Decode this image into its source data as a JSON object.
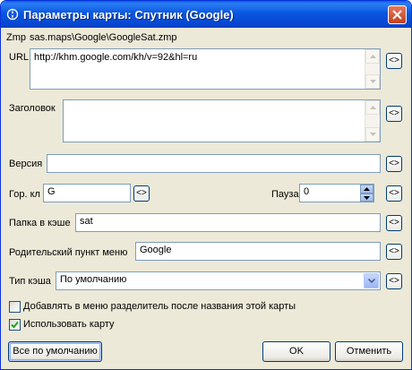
{
  "window": {
    "title": "Параметры карты: Спутник (Google)"
  },
  "zmp": {
    "label": "Zmp",
    "path": "sas.maps\\Google\\GoogleSat.zmp"
  },
  "url": {
    "label": "URL",
    "value": "http://khm.google.com/kh/v=92&hl=ru"
  },
  "header_field": {
    "label": "Заголовок",
    "value": ""
  },
  "version": {
    "label": "Версия",
    "value": ""
  },
  "hotkey": {
    "label": "Гор. кл",
    "value": "G"
  },
  "pause": {
    "label": "Пауза",
    "value": "0"
  },
  "cache_folder": {
    "label": "Папка в кэше",
    "value": "sat"
  },
  "parent_menu": {
    "label": "Родительский пункт меню",
    "value": "Google"
  },
  "cache_type": {
    "label": "Тип кэша",
    "selected": "По умолчанию"
  },
  "reset_button_label": "<>",
  "checkboxes": {
    "separator": {
      "label": "Добавлять в меню разделитель после названия этой карты",
      "checked": false
    },
    "use_map": {
      "label": "Использовать карту",
      "checked": true
    }
  },
  "buttons": {
    "defaults": "Все по умолчанию",
    "ok": "OK",
    "cancel": "Отменить"
  },
  "colors": {
    "titlebar": "#0a56e0",
    "face": "#ece9d8",
    "close": "#c3401e"
  }
}
